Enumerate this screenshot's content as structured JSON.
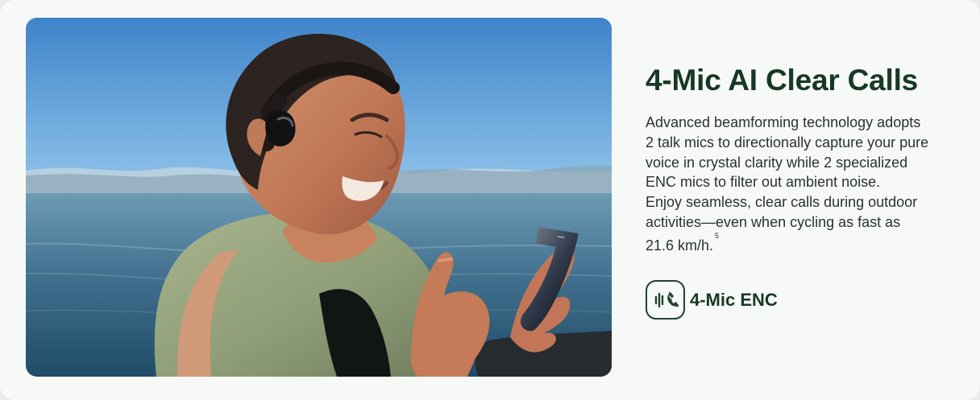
{
  "section": {
    "title": "4-Mic AI Clear Calls",
    "description_lines": [
      "Advanced beamforming technology adopts",
      "2 talk mics to directionally capture your pure",
      "voice in crystal clarity while 2 specialized",
      "ENC mics to filter out ambient noise.",
      "Enjoy seamless, clear calls during outdoor",
      "activities—even when cycling as fast as",
      "21.6 km/h."
    ],
    "footnote": "5"
  },
  "feature": {
    "icon": "phone-microphone-icon",
    "label": "4-Mic ENC"
  },
  "theme": {
    "accent": "#173826",
    "text": "#29332d",
    "background": "#f7f9f7"
  }
}
